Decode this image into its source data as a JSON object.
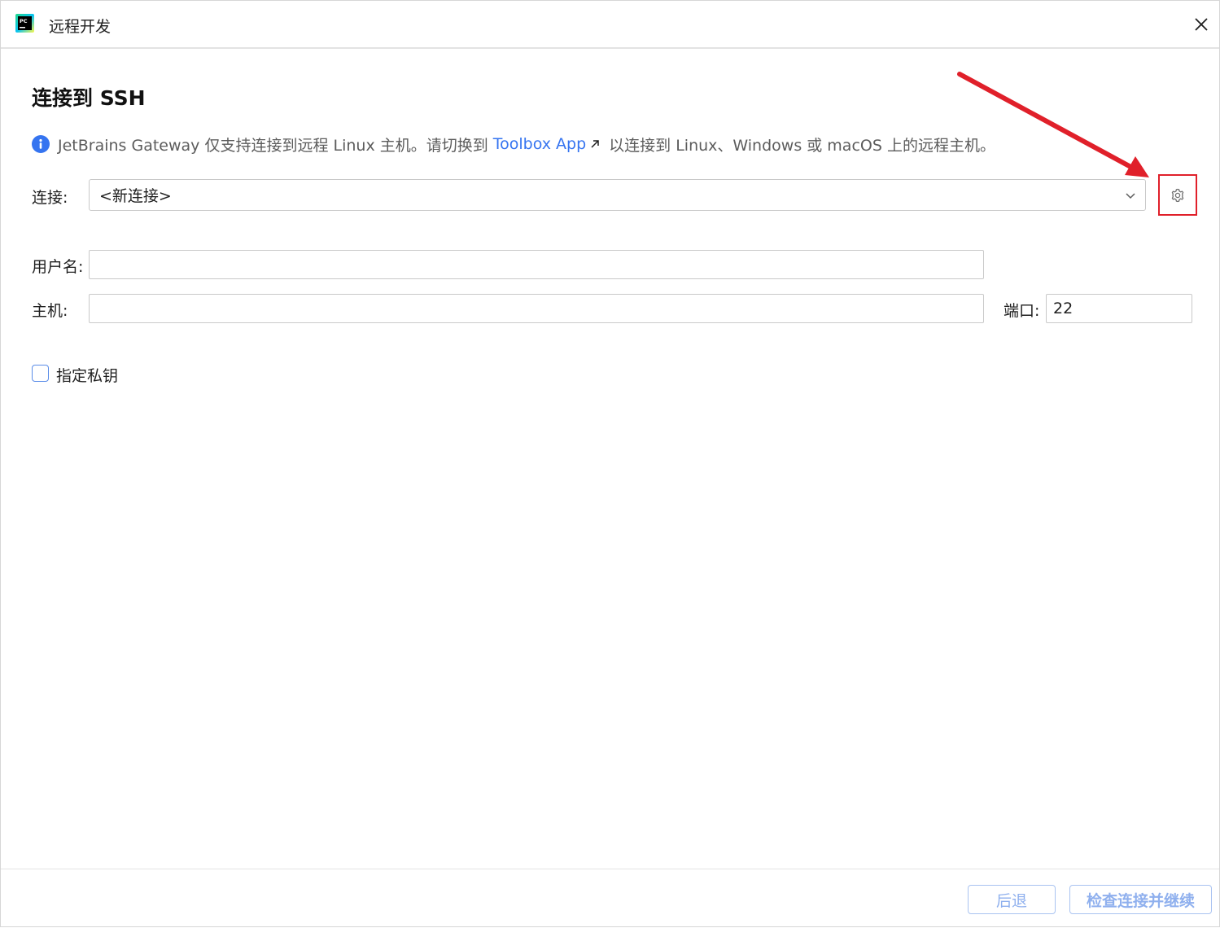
{
  "window": {
    "title": "远程开发",
    "app_icon_text": "PC"
  },
  "main": {
    "heading": "连接到 SSH",
    "info": {
      "text_before": "JetBrains Gateway 仅支持连接到远程 Linux 主机。请切换到",
      "link": "Toolbox App",
      "text_after": "以连接到 Linux、Windows 或 macOS 上的远程主机。"
    },
    "connection": {
      "label": "连接:",
      "value": "<新连接>"
    },
    "username": {
      "label": "用户名:",
      "value": ""
    },
    "host": {
      "label": "主机:",
      "value": ""
    },
    "port": {
      "label": "端口:",
      "value": "22"
    },
    "private_key": {
      "label": "指定私钥",
      "checked": false
    }
  },
  "footer": {
    "back_label": "后退",
    "continue_label": "检查连接并继续"
  },
  "colors": {
    "accent": "#3574f0",
    "annotation": "#e0202a",
    "disabled_button_text": "#8fb0ee"
  }
}
